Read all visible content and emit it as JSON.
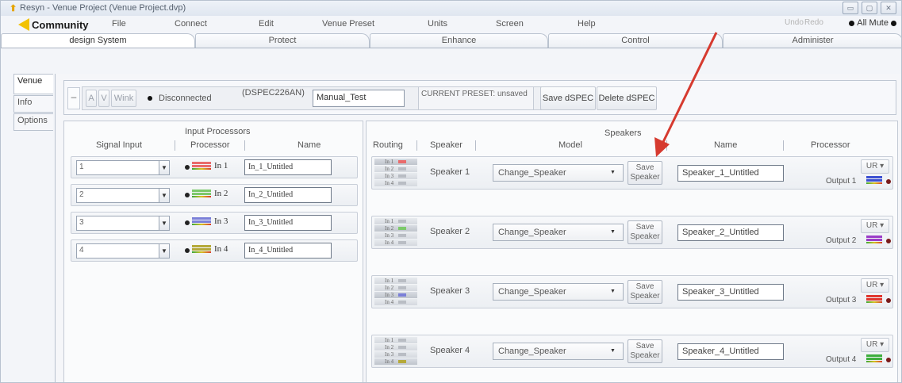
{
  "window": {
    "title": "Resyn - Venue Project (Venue Project.dvp)",
    "controls": [
      "▭",
      "▢",
      "✕"
    ]
  },
  "menu": {
    "brand": "Community",
    "items": [
      "File",
      "Connect",
      "Edit",
      "Venue Preset",
      "Units",
      "Screen",
      "Help"
    ],
    "undo": "Undo",
    "redo": "Redo",
    "all_mute": "All Mute"
  },
  "main_tabs": [
    "design System",
    "Protect",
    "Enhance",
    "Control",
    "Administer"
  ],
  "side_tabs": [
    "Venue",
    "Info",
    "Options"
  ],
  "toolbar": {
    "collapse": "–",
    "btn_a": "A",
    "btn_v": "V",
    "btn_wink": "Wink",
    "status": "Disconnected",
    "device": "(DSPEC226AN)",
    "device_name": "Manual_Test",
    "current_preset": "CURRENT PRESET: unsaved",
    "save_dspec": "Save dSPEC",
    "delete_dspec": "Delete dSPEC"
  },
  "input_processors": {
    "title": "Input Processors",
    "headers": {
      "signal_input": "Signal Input",
      "processor": "Processor",
      "name": "Name"
    },
    "rows": [
      {
        "signal": "1",
        "label": "In 1",
        "name": "In_1_Untitled",
        "meter_color": "#e96b6b"
      },
      {
        "signal": "2",
        "label": "In 2",
        "name": "In_2_Untitled",
        "meter_color": "#7cc96a"
      },
      {
        "signal": "3",
        "label": "In 3",
        "name": "In_3_Untitled",
        "meter_color": "#7a7fd8"
      },
      {
        "signal": "4",
        "label": "In 4",
        "name": "In_4_Untitled",
        "meter_color": "#b5a93a"
      }
    ]
  },
  "speakers": {
    "title": "Speakers",
    "headers": {
      "routing": "Routing",
      "speaker": "Speaker",
      "model": "Model",
      "name": "Name",
      "processor": "Processor"
    },
    "routing_labels": [
      "In 1",
      "In 2",
      "In 3",
      "In 4"
    ],
    "save_label_1": "Save",
    "save_label_2": "Speaker",
    "rows": [
      {
        "label": "Speaker 1",
        "model": "Change_Speaker",
        "name": "Speaker_1_Untitled",
        "proc": "UR ▾",
        "output": "Output 1",
        "out_color": "#3b4fd1",
        "selected_route": 0
      },
      {
        "label": "Speaker 2",
        "model": "Change_Speaker",
        "name": "Speaker_2_Untitled",
        "proc": "UR ▾",
        "output": "Output 2",
        "out_color": "#9b3dc8",
        "selected_route": 1
      },
      {
        "label": "Speaker 3",
        "model": "Change_Speaker",
        "name": "Speaker_3_Untitled",
        "proc": "UR ▾",
        "output": "Output 3",
        "out_color": "#e0362e",
        "selected_route": 2
      },
      {
        "label": "Speaker 4",
        "model": "Change_Speaker",
        "name": "Speaker_4_Untitled",
        "proc": "UR ▾",
        "output": "Output 4",
        "out_color": "#3fae3f",
        "selected_route": 3
      }
    ]
  },
  "route_colors": [
    "#e96b6b",
    "#7cc96a",
    "#7a7fd8",
    "#b5a93a"
  ],
  "annotation_color": "#d63a2f"
}
